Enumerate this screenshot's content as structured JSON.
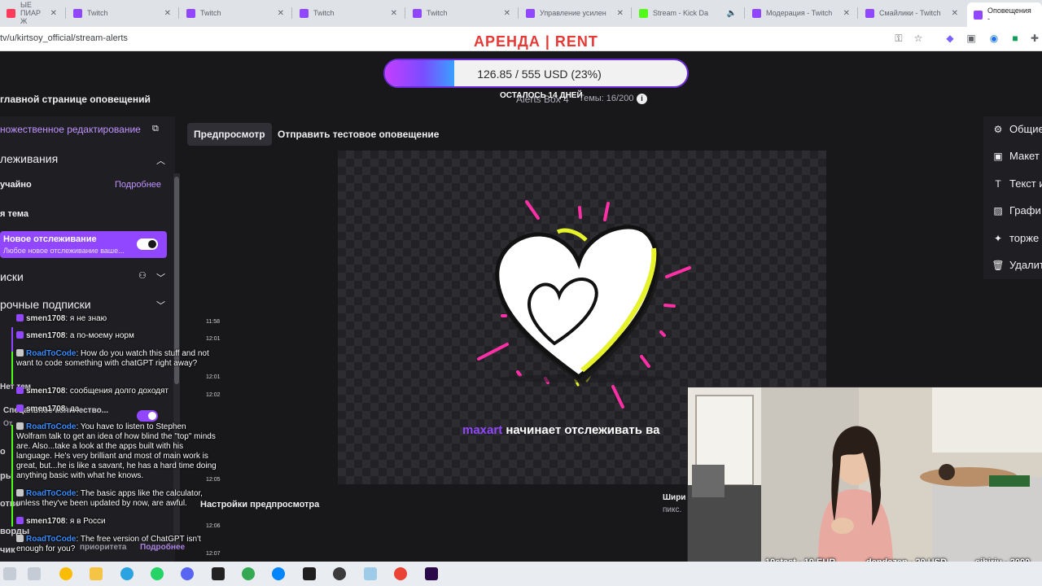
{
  "browser": {
    "tabs": [
      {
        "label": "ЫЕ ПИАР Ж",
        "active": false
      },
      {
        "label": "Twitch",
        "active": false
      },
      {
        "label": "Twitch",
        "active": false
      },
      {
        "label": "Twitch",
        "active": false
      },
      {
        "label": "Twitch",
        "active": false
      },
      {
        "label": "Управление усилен",
        "active": false
      },
      {
        "label": "Stream - Kick Da",
        "active": false
      },
      {
        "label": "Модерация - Twitch",
        "active": false
      },
      {
        "label": "Смайлики - Twitch",
        "active": false
      },
      {
        "label": "Оповещения -",
        "active": true
      }
    ],
    "url": "tv/u/kirtsoy_official/stream-alerts"
  },
  "overlay": {
    "rent": "АРЕНДА | RENT",
    "goal_text": "126.85 / 555 USD (23%)",
    "goal_progress": 0.23,
    "days_left": "ОСТАЛОСЬ 14 ДНЕЙ"
  },
  "header": {
    "back_link": "главной странице оповещений",
    "box_name": "Alerts Box 4",
    "themes": "Темы: 16/200",
    "info_icon": "i"
  },
  "left_panel": {
    "multi_edit": "ножественное редактирование",
    "section_follows": "леживания",
    "random": "учайно",
    "more": "Подробнее",
    "theme": "я тема",
    "active_item": {
      "title": "Новое отслеживание",
      "subtitle": "Любое новое отслеживание ваше..."
    },
    "section_subs": "иски",
    "section_gift_subs": "рочные подписки",
    "partial_hidden": [
      "Спецальное количество...",
      "От",
      "Нет тем",
      "о",
      "ры",
      "отве",
      "ворды",
      "чик",
      "приоритета",
      "Подробнее"
    ]
  },
  "toolbar": {
    "preview": "Предпросмотр",
    "send_test": "Отправить тестовое оповещение"
  },
  "preview": {
    "username": "maxart",
    "message": " начинает отслеживать ва",
    "settings": "Настройки предпросмотра",
    "width_label": "Шири",
    "px_label": "пикс."
  },
  "right_menu": [
    {
      "icon": "gear-icon",
      "glyph": "⚙",
      "label": "Общие"
    },
    {
      "icon": "layout-icon",
      "glyph": "▣",
      "label": "Макет"
    },
    {
      "icon": "text-icon",
      "glyph": "T",
      "label": "Текст и"
    },
    {
      "icon": "image-icon",
      "glyph": "▨",
      "label": "Графи"
    },
    {
      "icon": "celebration-icon",
      "glyph": "✦",
      "label": "торже"
    },
    {
      "icon": "trash-icon",
      "glyph": "🗑",
      "label": "Удалит"
    }
  ],
  "chat": [
    {
      "nick": "smen1708",
      "text": ": я не знаю",
      "time": "11:58",
      "platform": "twitch"
    },
    {
      "nick": "smen1708",
      "text": ": а по-моему норм",
      "time": "12:01",
      "platform": "twitch"
    },
    {
      "nick": "RoadToCode",
      "text": ": How do you watch this stuff and not want to code something with chatGPT right away?",
      "time": "12:01",
      "platform": "kick"
    },
    {
      "nick": "smen1708",
      "text": ": сообщения долго доходят",
      "time": "12:02",
      "platform": "twitch"
    },
    {
      "nick": "smen1708",
      "text": ": да",
      "time": "",
      "platform": "twitch"
    },
    {
      "nick": "RoadToCode",
      "text": ": You have to listen to Stephen Wolfram talk to get an idea of how blind the \"top\" minds are. Also...take a look at the apps built with his language. He's very brilliant and most of main work is great, but...he is like a savant, he has a hard time doing anything basic with what he knows.",
      "time": "12:05",
      "platform": "kick"
    },
    {
      "nick": "RoadToCode",
      "text": ": The basic apps like the calculator, unless they've been updated by now, are awful.",
      "time": "",
      "platform": "kick"
    },
    {
      "nick": "smen1708",
      "text": ": я в Росси",
      "time": "12:06",
      "platform": "twitch"
    },
    {
      "nick": "RoadToCode",
      "text": ": The free version of ChatGPT isn't enough for you?",
      "time": "12:07",
      "platform": "kick"
    }
  ],
  "donations": [
    {
      "text": "10stast - 10 EUR"
    },
    {
      "text": "dendazen - 20 USD"
    },
    {
      "text": "sibiriu - 2000"
    }
  ],
  "colors": {
    "twitch_purple": "#9147ff",
    "rent_red": "#e53935",
    "kick_green": "#53fc18",
    "heart_pink": "#ff2fa6",
    "heart_yellow": "#e6f22a"
  }
}
